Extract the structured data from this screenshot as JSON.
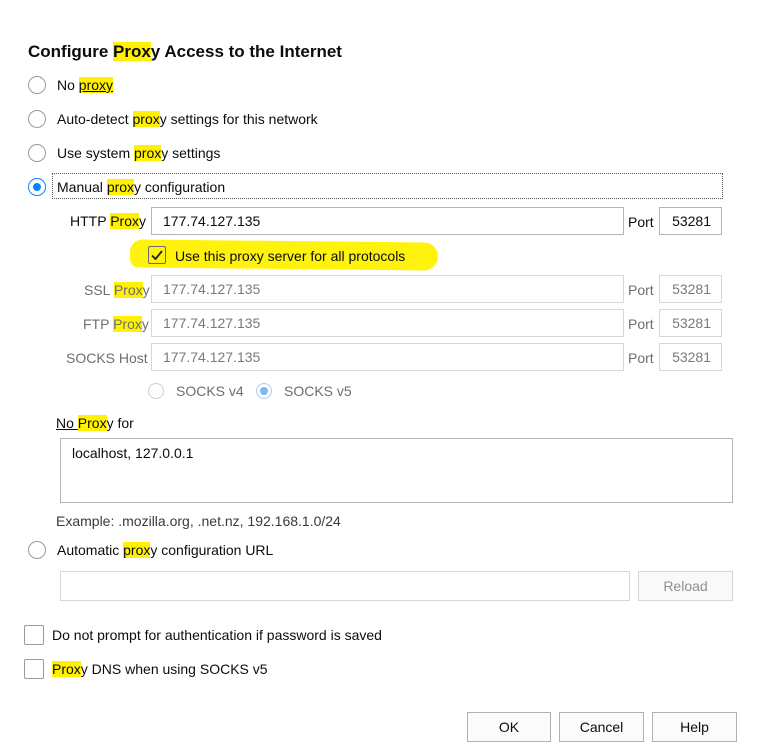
{
  "dialog": {
    "title_pre": "Configure ",
    "title_hl": "Prox",
    "title_post": "y Access to the Internet"
  },
  "options": {
    "no_proxy": {
      "pre": "No ",
      "hl": "proxy",
      "post": ""
    },
    "auto_detect": {
      "pre": "Auto-detect ",
      "hl": "prox",
      "post": "y settings for this network"
    },
    "system": {
      "pre": "Use system ",
      "hl": "prox",
      "post": "y settings"
    },
    "manual": {
      "pre": "Manual ",
      "hl": "prox",
      "post": "y configuration",
      "selected": true
    },
    "auto_url": {
      "pre": "Automatic ",
      "hl": "prox",
      "post": "y configuration URL"
    }
  },
  "http": {
    "label_pre": "HTTP ",
    "label_hl": "Prox",
    "label_post": "y",
    "value": "177.74.127.135",
    "port_label": "Port",
    "port": "53281"
  },
  "share": {
    "label": "Use this proxy server for all protocols",
    "checked": true
  },
  "ssl": {
    "label_pre": "SSL ",
    "label_hl": "Prox",
    "label_post": "y",
    "value": "177.74.127.135",
    "port_label": "Port",
    "port": "53281"
  },
  "ftp": {
    "label_pre": "FTP ",
    "label_hl": "Prox",
    "label_post": "y",
    "value": "177.74.127.135",
    "port_label": "Port",
    "port": "53281"
  },
  "socks": {
    "label": "SOCKS Host",
    "value": "177.74.127.135",
    "port_label": "Port",
    "port": "53281",
    "v4": "SOCKS v4",
    "v5": "SOCKS v5",
    "selected": "v5"
  },
  "no_proxy_for": {
    "label_pre": "No ",
    "label_hl": "Prox",
    "label_post": "y for",
    "value": "localhost, 127.0.0.1",
    "example": "Example: .mozilla.org, .net.nz, 192.168.1.0/24"
  },
  "auto_url": {
    "value": "",
    "reload": "Reload"
  },
  "checkboxes": {
    "no_prompt": "Do not prompt for authentication if password is saved",
    "dns_hl": "Prox",
    "dns_post": "y DNS when using SOCKS v5"
  },
  "buttons": {
    "ok": "OK",
    "cancel": "Cancel",
    "help": "Help"
  },
  "colors": {
    "highlight": "#fff100",
    "accent": "#0a84ff"
  }
}
